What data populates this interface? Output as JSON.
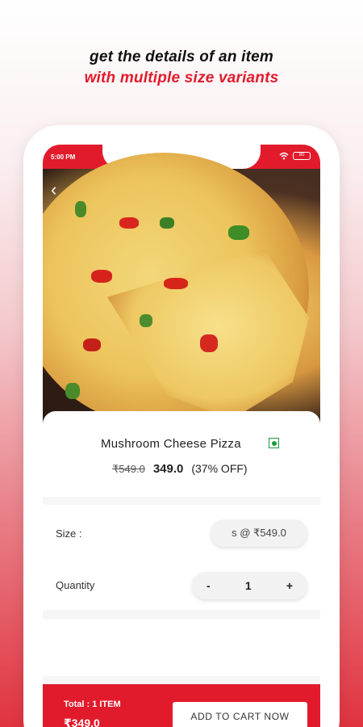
{
  "promo": {
    "line1": "get the details of an item",
    "line2": "with multiple size variants"
  },
  "colors": {
    "accent": "#e21b2c",
    "veg": "#1f9a3b"
  },
  "statusbar": {
    "time": "5:00 PM",
    "battery": "80"
  },
  "product": {
    "name": "Mushroom Cheese Pizza",
    "old_price": "₹549.0",
    "new_price": "349.0",
    "discount": "(37% OFF)",
    "veg_icon": "veg-indicator-icon"
  },
  "options": {
    "size_label": "Size :",
    "size_value": "s @ ₹549.0",
    "quantity_label": "Quantity",
    "minus": "-",
    "quantity": "1",
    "plus": "+"
  },
  "cart": {
    "total_label": "Total : 1 ITEM",
    "total_price": "₹349.0",
    "add_button": "ADD TO CART NOW"
  }
}
